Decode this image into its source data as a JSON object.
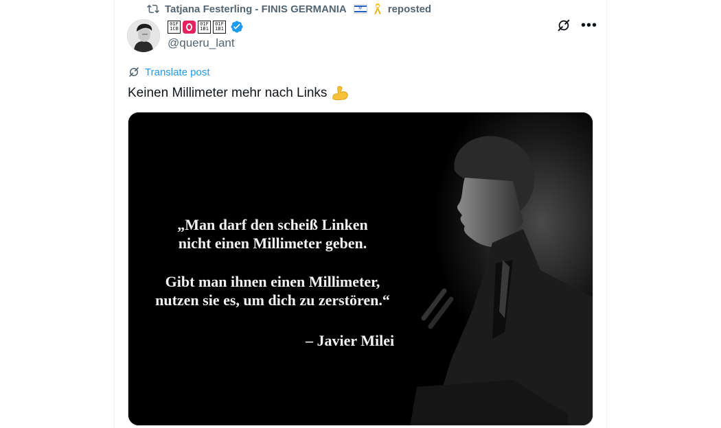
{
  "repost": {
    "label": "Tatjana Festerling - FINIS GERMANIA",
    "suffix": "reposted"
  },
  "author": {
    "display_glyphs": [
      "01F 1CB",
      "01F 1B1"
    ],
    "handle": "@queru_lant",
    "verified": true
  },
  "actions": {
    "translate_label": "Translate post"
  },
  "post": {
    "text": "Keinen Millimeter mehr nach Links"
  },
  "media": {
    "quote_line_1": "„Man darf den scheiß Linken",
    "quote_line_2": "nicht einen Millimeter geben.",
    "quote_line_3": "Gibt man ihnen einen Millimeter,",
    "quote_line_4": "nutzen sie es, um dich zu zerstören.“",
    "attribution": "– Javier Milei"
  },
  "colors": {
    "accent": "#1d9bf0",
    "secondary_text": "#536471",
    "verified_badge": "#1d9bf0",
    "red_badge": "#e0245e"
  },
  "icons": [
    "repost-icon",
    "israel-flag-icon",
    "yellow-ribbon-icon",
    "verified-badge-icon",
    "grok-icon",
    "more-icon",
    "translate-icon",
    "flexed-biceps-icon"
  ]
}
